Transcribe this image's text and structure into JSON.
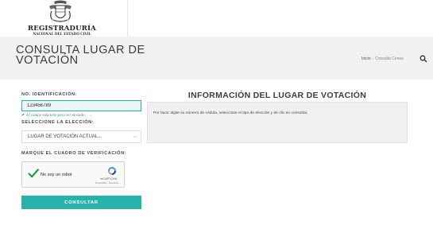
{
  "header": {
    "logo_title": "REGISTRADURÍA",
    "logo_subtitle": "NACIONAL DEL ESTADO CIVIL"
  },
  "title_band": {
    "page_title": "CONSULTA LUGAR DE VOTACIÓN",
    "breadcrumbs": [
      {
        "label": "Inicio"
      },
      {
        "label": "Consulta Censo"
      }
    ],
    "search_icon": "search-icon"
  },
  "form": {
    "id_label": "NO. IDENTIFICACIÓN:",
    "id_value": "123456789",
    "validation_text": "El campo está listo para ser enviado.",
    "validation_mark": "✔",
    "election_label": "SELECCIONE LA ELECCIÓN:",
    "election_value": "LUGAR DE VOTACIÓN ACTUAL...",
    "captcha_label": "MARQUE EL CUADRO DE VERIFICACIÓN:",
    "captcha": {
      "checkbox_label": "No soy un robot",
      "brand": "reCAPTCHA",
      "links": "Privacidad - Términos",
      "checked": true
    },
    "submit_label": "CONSULTAR"
  },
  "info": {
    "title": "INFORMACIÓN DEL LUGAR DE VOTACIÓN",
    "message": "Por favor digite su número de cédula, seleccione el tipo de elección y dé clic en consultar."
  },
  "colors": {
    "accent": "#29b2a9",
    "band_bg": "#f1f1f1",
    "valid_green": "#2a9d3c"
  }
}
